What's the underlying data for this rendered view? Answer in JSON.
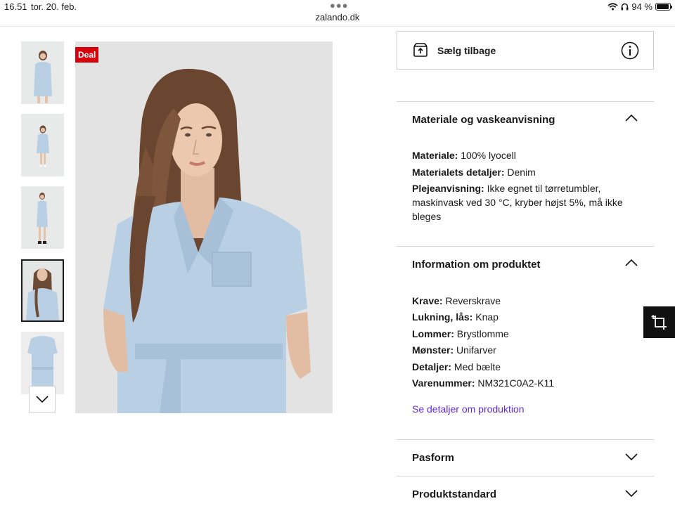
{
  "status_bar": {
    "time": "16.51",
    "date": "tor. 20. feb.",
    "url": "zalando.dk",
    "battery": "94 %",
    "battery_level": 0.94
  },
  "gallery": {
    "deal_badge": "Deal",
    "thumbnail_count": 5,
    "active_thumbnail": 4
  },
  "sell_back": {
    "label": "Sælg tilbage",
    "icon": "box-return-icon",
    "info_icon": "info-icon"
  },
  "material_section": {
    "title": "Materiale og vaskeanvisning",
    "expanded": true,
    "rows": [
      {
        "key": "Materiale:",
        "value": "100% lyocell"
      },
      {
        "key": "Materialets detaljer:",
        "value": "Denim"
      },
      {
        "key": "Plejeanvisning:",
        "value": "Ikke egnet til tørretumbler, maskinvask ved 30 °C, kryber højst 5%, må ikke bleges"
      }
    ]
  },
  "product_info_section": {
    "title": "Information om produktet",
    "expanded": true,
    "rows": [
      {
        "key": "Krave:",
        "value": "Reverskrave"
      },
      {
        "key": "Lukning, lås:",
        "value": "Knap"
      },
      {
        "key": "Lommer:",
        "value": "Brystlomme"
      },
      {
        "key": "Mønster:",
        "value": "Unifarver"
      },
      {
        "key": "Detaljer:",
        "value": "Med bælte"
      },
      {
        "key": "Varenummer:",
        "value": "NM321C0A2-K11"
      }
    ],
    "link": "Se detaljer om produktion"
  },
  "fit_section": {
    "title": "Pasform",
    "expanded": false
  },
  "standard_section": {
    "title": "Produktstandard",
    "expanded": false
  },
  "colors": {
    "deal": "#d5000b",
    "link": "#6328e0",
    "dress": "#b9cfe3"
  }
}
